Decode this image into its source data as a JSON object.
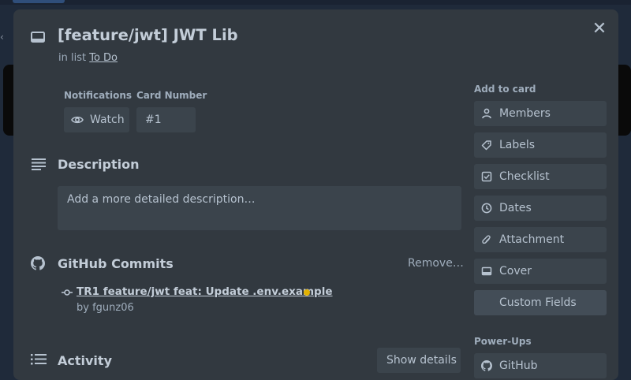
{
  "card": {
    "title": "[feature/jwt] JWT Lib",
    "in_list_prefix": "in list",
    "list_name": "To Do"
  },
  "meta": {
    "notifications_label": "Notifications",
    "watch_label": "Watch",
    "card_number_label": "Card Number",
    "card_number": "#1"
  },
  "description": {
    "title": "Description",
    "placeholder": "Add a more detailed description…"
  },
  "github": {
    "title": "GitHub Commits",
    "remove_label": "Remove…",
    "commit_text": "TR1 feature/jwt feat: Update .env.example",
    "commit_author": "by fgunz06",
    "status_color": "#e2b203"
  },
  "activity": {
    "title": "Activity",
    "show_details_label": "Show details"
  },
  "sidebar": {
    "add_to_card_label": "Add to card",
    "buttons": [
      {
        "label": "Members",
        "icon": "person-icon"
      },
      {
        "label": "Labels",
        "icon": "tag-icon"
      },
      {
        "label": "Checklist",
        "icon": "checkbox-icon"
      },
      {
        "label": "Dates",
        "icon": "clock-icon"
      },
      {
        "label": "Attachment",
        "icon": "paperclip-icon"
      },
      {
        "label": "Cover",
        "icon": "cover-icon"
      },
      {
        "label": "Custom Fields",
        "icon": ""
      }
    ],
    "power_ups_label": "Power-Ups",
    "power_ups": [
      {
        "label": "GitHub",
        "icon": "github-icon"
      }
    ]
  },
  "colors": {
    "modal_bg": "#323940",
    "button_bg": "#3b444c",
    "text": "#b6c2cf"
  }
}
